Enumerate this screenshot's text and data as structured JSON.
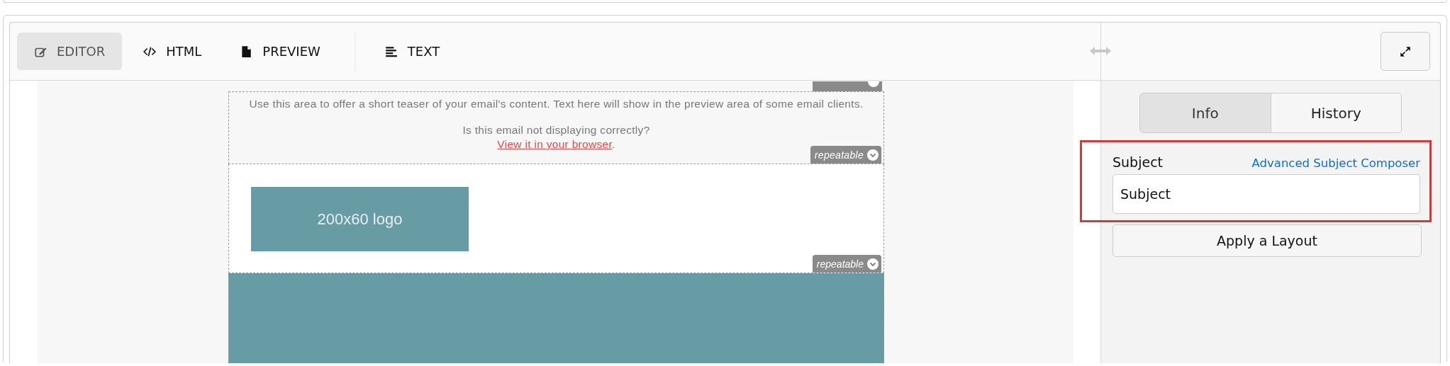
{
  "editor_tabs": [
    {
      "label": "EDITOR",
      "kind": "edit",
      "selected": true
    },
    {
      "label": "HTML",
      "kind": "code",
      "selected": false
    },
    {
      "label": "PREVIEW",
      "kind": "document",
      "selected": false
    },
    {
      "label": "TEXT",
      "kind": "lines",
      "selected": false
    }
  ],
  "email": {
    "top_badge": true,
    "sections": [
      {
        "kind": "preheader",
        "teaser": "Use this area to offer a short teaser of your email's content. Text here will show in the preview area of some email clients.",
        "notice": "Is this email not displaying correctly?",
        "link": "View it in your browser",
        "trailing": ".",
        "badge": "repeatable"
      },
      {
        "kind": "logo",
        "logo_text": "200x60 logo",
        "badge": "repeatable"
      },
      {
        "kind": "hero"
      }
    ]
  },
  "side_tabs": [
    {
      "label": "Info",
      "selected": true
    },
    {
      "label": "History",
      "selected": false
    }
  ],
  "subject": {
    "label": "Subject",
    "link": "Advanced Subject Composer",
    "value": "Subject",
    "highlighted": true
  },
  "apply_button": "Apply a Layout"
}
